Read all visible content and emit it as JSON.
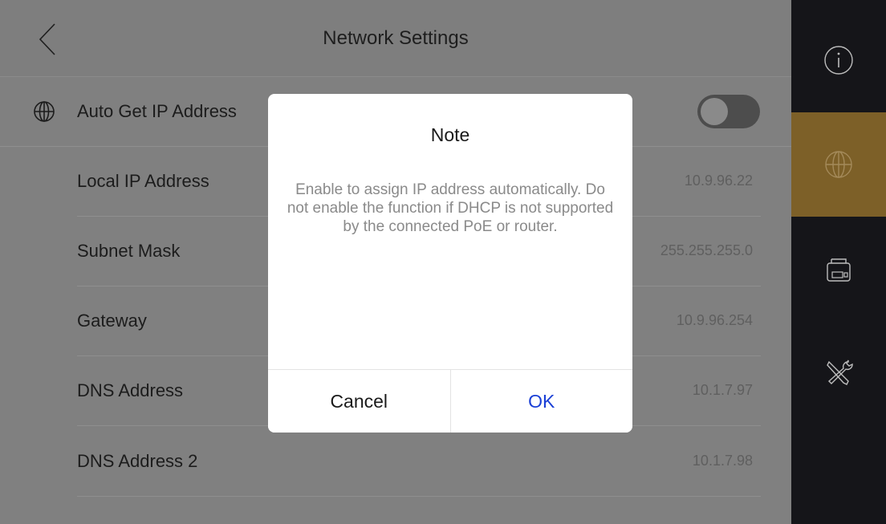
{
  "header": {
    "title": "Network Settings",
    "back_icon": "chevron-left-icon"
  },
  "auto_ip": {
    "icon": "globe-icon",
    "label": "Auto Get IP Address",
    "enabled": false
  },
  "rows": [
    {
      "label": "Local IP Address",
      "value": "10.9.96.22"
    },
    {
      "label": "Subnet Mask",
      "value": "255.255.255.0"
    },
    {
      "label": "Gateway",
      "value": "10.9.96.254"
    },
    {
      "label": "DNS Address",
      "value": "10.1.7.97"
    },
    {
      "label": "DNS Address 2",
      "value": "10.1.7.98"
    }
  ],
  "sidebar": {
    "items": [
      {
        "icon": "info-icon",
        "active": false
      },
      {
        "icon": "globe-icon",
        "active": true
      },
      {
        "icon": "device-icon",
        "active": false
      },
      {
        "icon": "tools-icon",
        "active": false
      }
    ],
    "active_color": "#7d6028"
  },
  "dialog": {
    "title": "Note",
    "message": "Enable to assign IP address automatically. Do not enable the function if DHCP is not supported by the connected PoE or router.",
    "cancel_label": "Cancel",
    "ok_label": "OK",
    "ok_color": "#1a3fd6"
  }
}
